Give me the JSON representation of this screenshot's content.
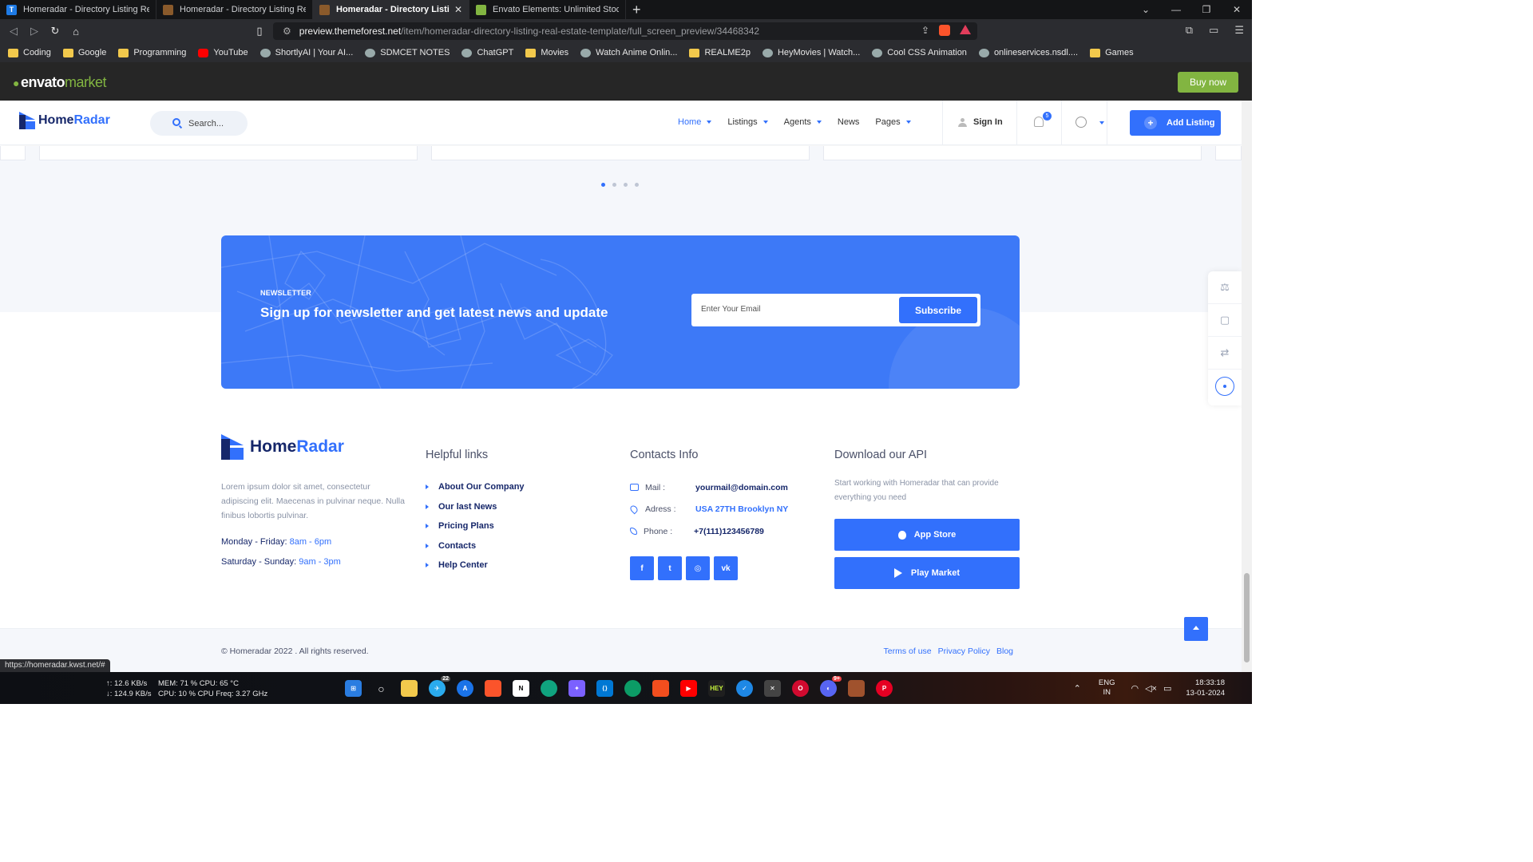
{
  "browser": {
    "tabs": [
      {
        "title": "Homeradar - Directory Listing Real Est",
        "active": false,
        "favicon_color": "#1e7be6",
        "favicon_letter": "T"
      },
      {
        "title": "Homeradar - Directory Listing Real Est",
        "active": false,
        "favicon_color": "#8a5a2b",
        "favicon_letter": ""
      },
      {
        "title": "Homeradar - Directory Listing Re",
        "active": true,
        "favicon_color": "#8a5a2b",
        "favicon_letter": ""
      },
      {
        "title": "Envato Elements: Unlimited Stock Vide",
        "active": false,
        "favicon_color": "#82b541",
        "favicon_letter": ""
      }
    ],
    "new_tab_glyph": "+",
    "url_host": "preview.themeforest.net",
    "url_path": "/item/homeradar-directory-listing-real-estate-template/full_screen_preview/34468342",
    "bookmarks": [
      {
        "label": "Coding",
        "icon": "folder-icon"
      },
      {
        "label": "Google",
        "icon": "folder-icon"
      },
      {
        "label": "Programming",
        "icon": "folder-icon"
      },
      {
        "label": "YouTube",
        "icon": "youtube-icon"
      },
      {
        "label": "ShortlyAI | Your AI...",
        "icon": "site-icon"
      },
      {
        "label": "SDMCET NOTES",
        "icon": "site-icon"
      },
      {
        "label": "ChatGPT",
        "icon": "site-icon"
      },
      {
        "label": "Movies",
        "icon": "folder-icon"
      },
      {
        "label": "Watch Anime Onlin...",
        "icon": "site-icon"
      },
      {
        "label": "REALME2p",
        "icon": "folder-icon"
      },
      {
        "label": "HeyMovies | Watch...",
        "icon": "site-icon"
      },
      {
        "label": "Cool CSS Animation",
        "icon": "site-icon"
      },
      {
        "label": "onlineservices.nsdl....",
        "icon": "site-icon"
      },
      {
        "label": "Games",
        "icon": "folder-icon"
      }
    ],
    "status_url": "https://homeradar.kwst.net/#"
  },
  "envato": {
    "logo_main": "envato",
    "logo_sub": "market",
    "buy_now": "Buy now"
  },
  "header": {
    "logo_a": "Home",
    "logo_b": "Radar",
    "search_placeholder": "Search...",
    "nav": [
      {
        "label": "Home",
        "dropdown": true,
        "active": true
      },
      {
        "label": "Listings",
        "dropdown": true,
        "active": false
      },
      {
        "label": "Agents",
        "dropdown": true,
        "active": false
      },
      {
        "label": "News",
        "dropdown": false,
        "active": false
      },
      {
        "label": "Pages",
        "dropdown": true,
        "active": false
      }
    ],
    "sign_in": "Sign In",
    "notifications_count": "5",
    "add_listing": "Add Listing",
    "add_listing_icon": "+"
  },
  "slider": {
    "dots": 4,
    "active_dot": 0
  },
  "newsletter": {
    "label": "NEWSLETTER",
    "title": "Sign up for newsletter and get latest news and update",
    "email_placeholder": "Enter Your Email",
    "subscribe": "Subscribe"
  },
  "footer": {
    "logo_a": "Home",
    "logo_b": "Radar",
    "about": "Lorem ipsum dolor sit amet, consectetur adipiscing elit. Maecenas in pulvinar neque. Nulla finibus lobortis pulvinar.",
    "hours": [
      {
        "days": "Monday - Friday:",
        "time": "8am - 6pm"
      },
      {
        "days": "Saturday - Sunday:",
        "time": "9am - 3pm"
      }
    ],
    "helpful_title": "Helpful links",
    "links": [
      "About Our Company",
      "Our last News",
      "Pricing Plans",
      "Contacts",
      "Help Center"
    ],
    "contacts_title": "Contacts Info",
    "contacts": [
      {
        "key": "Mail :",
        "value": "yourmail@domain.com",
        "icon": "mail-icon",
        "blue": false
      },
      {
        "key": "Adress :",
        "value": "USA 27TH Brooklyn NY",
        "icon": "map-pin-icon",
        "blue": true
      },
      {
        "key": "Phone :",
        "value": "+7(111)123456789",
        "icon": "phone-icon",
        "blue": false
      }
    ],
    "social": [
      {
        "name": "facebook-icon",
        "glyph": "f"
      },
      {
        "name": "twitter-icon",
        "glyph": "t"
      },
      {
        "name": "instagram-icon",
        "glyph": "◎"
      },
      {
        "name": "vk-icon",
        "glyph": "vk"
      }
    ],
    "api_title": "Download our API",
    "api_desc": "Start working with Homeradar that can provide everything you need",
    "app_store": "App Store",
    "play_market": "Play Market",
    "copyright": "© Homeradar 2022 . All rights reserved.",
    "legal": [
      "Terms of use",
      "Privacy Policy",
      "Blog"
    ]
  },
  "taskbar": {
    "net_up": "↑: 12.6 KB/s",
    "net_down": "↓: 124.9 KB/s",
    "mem": "MEM: 71 %  CPU: 65 °C",
    "cpu": "CPU: 10 %   CPU Freq: 3.27 GHz",
    "telegram_badge": "22",
    "discord_badge": "9+",
    "lang_a": "ENG",
    "lang_b": "IN",
    "time": "18:33:18",
    "date": "13-01-2024"
  },
  "colors": {
    "primary": "#3270fc",
    "navy": "#16276a",
    "envato_green": "#82b541"
  }
}
